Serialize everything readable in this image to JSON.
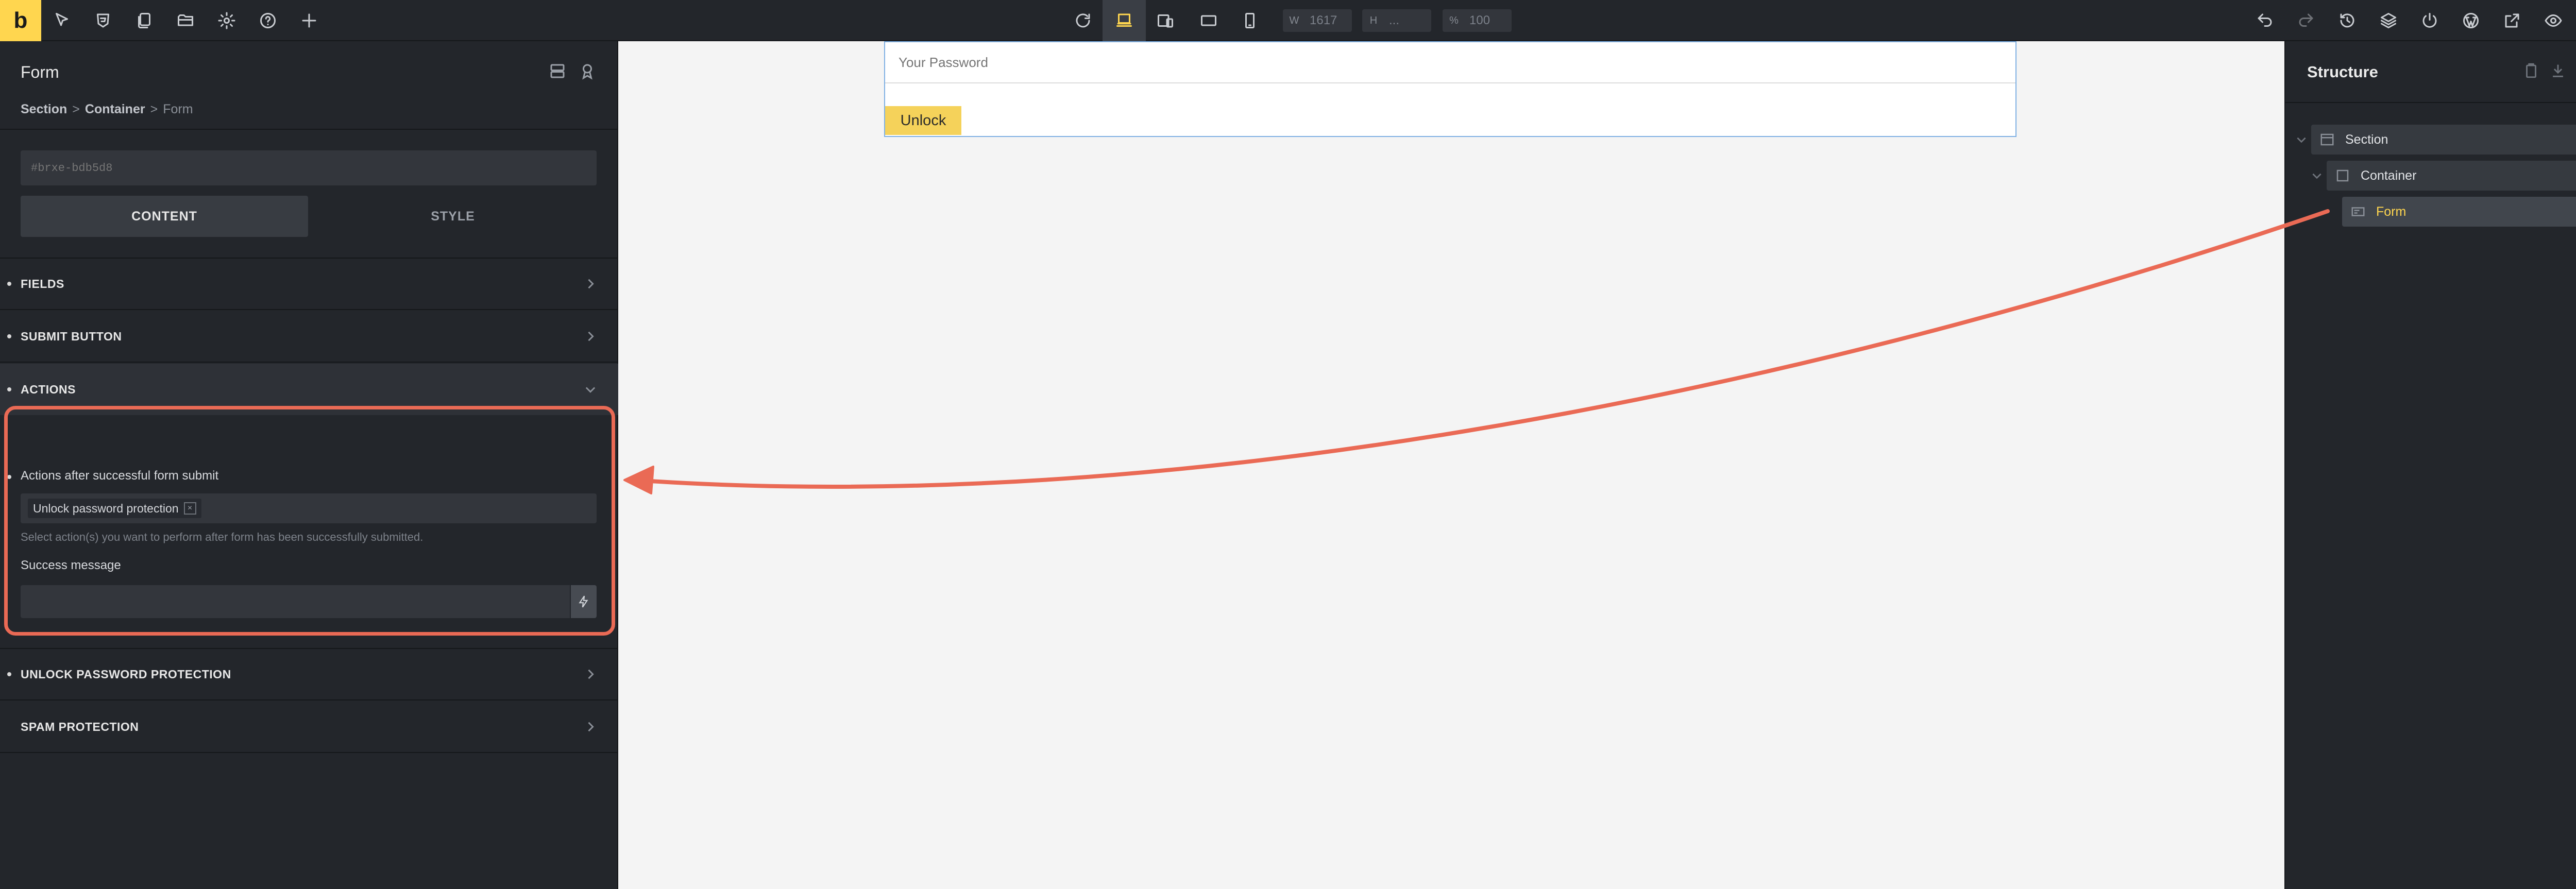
{
  "app": {
    "logo": "b"
  },
  "toolbar": {
    "width": {
      "label": "W",
      "value": "1617"
    },
    "height": {
      "label": "H",
      "value": "..."
    },
    "zoom": {
      "label": "%",
      "value": "100"
    }
  },
  "left_panel": {
    "title": "Form",
    "breadcrumb": [
      "Section",
      "Container"
    ],
    "breadcrumb_current": "Form",
    "element_id_placeholder": "#brxe-bdb5d8",
    "tabs": {
      "content": "CONTENT",
      "style": "STYLE"
    },
    "sections": {
      "fields": "FIELDS",
      "submit_button": "SUBMIT BUTTON",
      "actions": "ACTIONS",
      "unlock_password_protection": "UNLOCK PASSWORD PROTECTION",
      "spam_protection": "SPAM PROTECTION"
    },
    "actions": {
      "label": "Actions after successful form submit",
      "selected_tag": "Unlock password protection",
      "tag_remove": "×",
      "hint": "Select action(s) you want to perform after form has been successfully submitted.",
      "success_label": "Success message",
      "success_value": ""
    }
  },
  "canvas": {
    "password_placeholder": "Your Password",
    "unlock_button": "Unlock"
  },
  "structure": {
    "title": "Structure",
    "items": [
      {
        "label": "Section"
      },
      {
        "label": "Container"
      },
      {
        "label": "Form"
      }
    ]
  },
  "colors": {
    "accent": "#ffd64f",
    "panel_bg": "#23262b",
    "canvas_bg": "#f4f4f4",
    "annotation": "#ea6a55",
    "selection_outline": "#7fb0e3",
    "button_bg": "#f5d25a"
  }
}
